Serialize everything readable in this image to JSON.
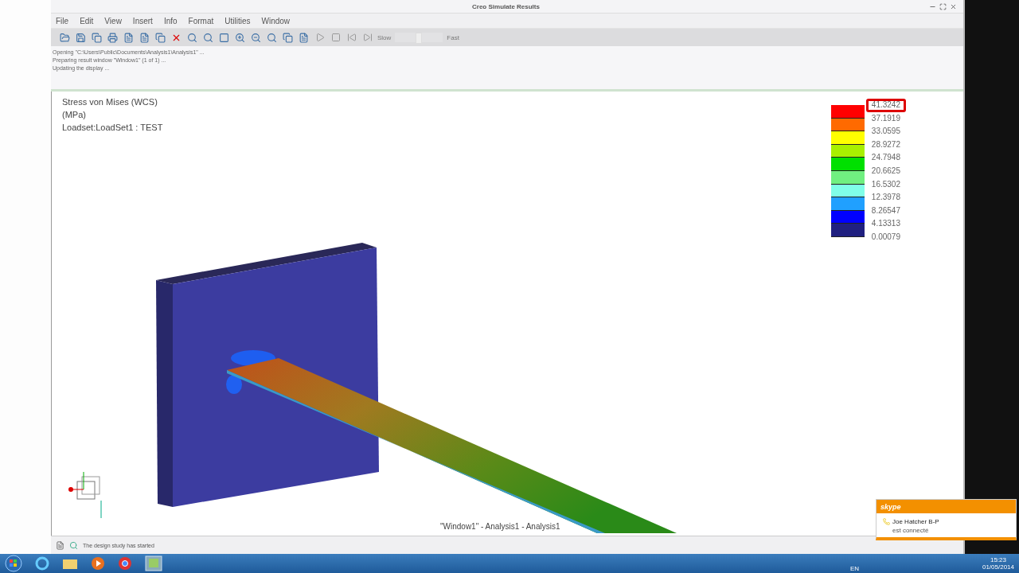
{
  "window": {
    "title": "Creo Simulate Results"
  },
  "menu": [
    "File",
    "Edit",
    "View",
    "Insert",
    "Info",
    "Format",
    "Utilities",
    "Window"
  ],
  "toolbar": {
    "slow_label": "Slow",
    "fast_label": "Fast",
    "speed": {
      "level": 0.5
    }
  },
  "messages": [
    "Opening \"C:\\Users\\Public\\Documents\\Analysis1\\Analysis1\" ...",
    "Preparing result window \"Window1\" (1 of 1) ...",
    "Updating the display ..."
  ],
  "viewport": {
    "labels": [
      "Stress von Mises (WCS)",
      "(MPa)",
      "Loadset:LoadSet1 :  TEST"
    ],
    "caption": "\"Window1\" - Analysis1 - Analysis1"
  },
  "legend": [
    {
      "value": "41.3242",
      "color": "#ff0000",
      "highlighted": true
    },
    {
      "value": "37.1919",
      "color": "#ff6a00",
      "highlighted": false
    },
    {
      "value": "33.0595",
      "color": "#ffff00",
      "highlighted": false
    },
    {
      "value": "28.9272",
      "color": "#a8f000",
      "highlighted": false
    },
    {
      "value": "24.7948",
      "color": "#00e000",
      "highlighted": false
    },
    {
      "value": "20.6625",
      "color": "#70f080",
      "highlighted": false
    },
    {
      "value": "16.5302",
      "color": "#80ffe8",
      "highlighted": false
    },
    {
      "value": "12.3978",
      "color": "#20a0ff",
      "highlighted": false
    },
    {
      "value": "8.26547",
      "color": "#0000ff",
      "highlighted": false
    },
    {
      "value": "4.13313",
      "color": "#202080",
      "highlighted": false
    },
    {
      "value": "0.00079",
      "highlighted": false
    }
  ],
  "status": {
    "text": "The design study has started"
  },
  "taskbar": {
    "language": "EN",
    "time": "15:23",
    "date": "01/05/2014"
  },
  "notification": {
    "app": "skype",
    "name": "Joe Hatcher B-P",
    "message": "est connecté"
  }
}
